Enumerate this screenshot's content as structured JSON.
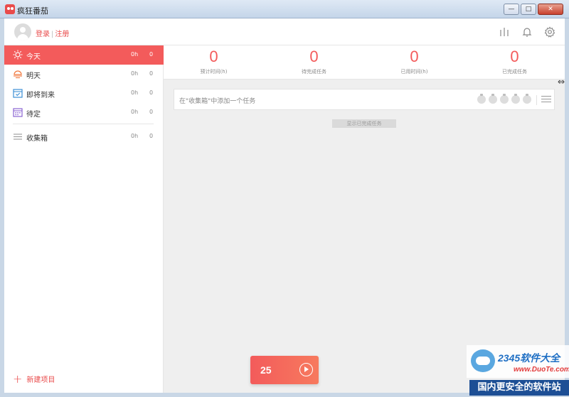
{
  "window": {
    "title": "疯狂番茄"
  },
  "header": {
    "login": "登录",
    "separator": "|",
    "register": "注册"
  },
  "sidebar": {
    "items": [
      {
        "label": "今天",
        "hours": "0h",
        "count": "0",
        "icon": "sun-icon"
      },
      {
        "label": "明天",
        "hours": "0h",
        "count": "0",
        "icon": "sunset-icon"
      },
      {
        "label": "即将到来",
        "hours": "0h",
        "count": "0",
        "icon": "calendar-check-icon"
      },
      {
        "label": "待定",
        "hours": "0h",
        "count": "0",
        "icon": "calendar-icon"
      },
      {
        "label": "收集箱",
        "hours": "0h",
        "count": "0",
        "icon": "list-icon"
      }
    ],
    "new_project": "新建项目"
  },
  "stats": [
    {
      "value": "0",
      "caption": "预计时间(h)"
    },
    {
      "value": "0",
      "caption": "待完成任务"
    },
    {
      "value": "0",
      "caption": "已用时间(h)"
    },
    {
      "value": "0",
      "caption": "已完成任务"
    }
  ],
  "task_input": {
    "placeholder": "在\"收集箱\"中添加一个任务"
  },
  "completed_toggle": "显示已完成任务",
  "timer": {
    "value": "25"
  },
  "watermark": {
    "brand": "2345软件大全",
    "url": "www.DuoTe.com",
    "slogan": "国内更安全的软件站"
  },
  "colors": {
    "accent": "#f35b5b",
    "main_bg": "#efefef"
  }
}
